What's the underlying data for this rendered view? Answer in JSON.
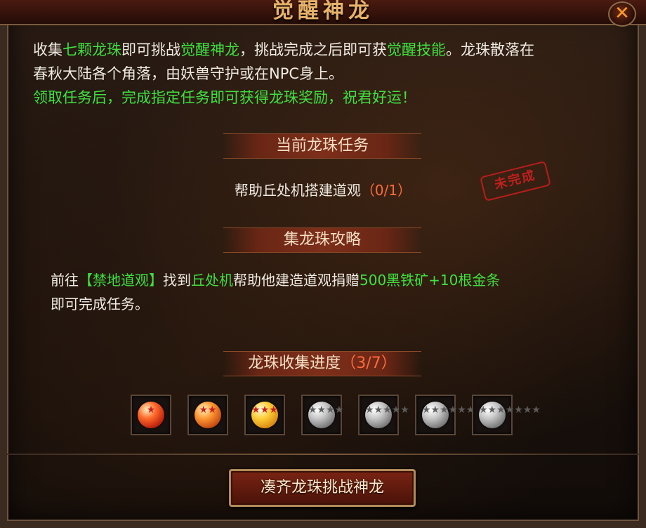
{
  "window": {
    "title": "觉醒神龙"
  },
  "intro": {
    "line1_a": "收集",
    "line1_hl1": "七颗龙珠",
    "line1_b": "即可挑战",
    "line1_hl2": "觉醒神龙",
    "line1_c": "，挑战完成之后即可获",
    "line1_hl3": "觉醒技能",
    "line1_d": "。龙珠散落在",
    "line2": "春秋大陆各个角落，由妖兽守护或在NPC身上。",
    "line3": "领取任务后，完成指定任务即可获得龙珠奖励，祝君好运！"
  },
  "current_task": {
    "header": "当前龙珠任务",
    "name": "帮助丘处机搭建道观",
    "progress": "（0/1）",
    "status_stamp": "未完成"
  },
  "guide": {
    "header": "集龙珠攻略",
    "text_a": "前往",
    "location": "【禁地道观】",
    "text_b": "找到",
    "npc": "丘处机",
    "text_c": "帮助他建造道观捐赠",
    "items": "500黑铁矿+10根金条",
    "text_d": "即可完成任务。"
  },
  "collection": {
    "label": "龙珠收集进度",
    "count": "（3/7）",
    "collected": 3,
    "total": 7,
    "orbs": [
      {
        "stars": "★",
        "state": "collected"
      },
      {
        "stars": "★★",
        "state": "collected"
      },
      {
        "stars": "★★★",
        "state": "collected"
      },
      {
        "stars": "★★★★",
        "state": "empty"
      },
      {
        "stars": "★★★★★",
        "state": "empty"
      },
      {
        "stars": "★★★★★★",
        "state": "empty"
      },
      {
        "stars": "★★★★★★★",
        "state": "empty"
      }
    ]
  },
  "actions": {
    "challenge_label": "凑齐龙珠挑战神龙",
    "close_symbol": "✕"
  },
  "colors": {
    "highlight_green": "#3fe03f",
    "progress_orange": "#ff6a3a",
    "stamp_red": "#d11f1f"
  }
}
